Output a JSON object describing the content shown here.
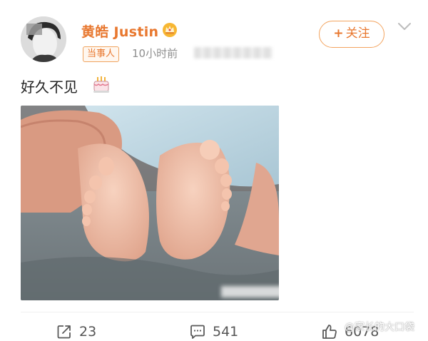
{
  "post": {
    "author": {
      "name": "黄皓 Justin",
      "badge": "当事人"
    },
    "time": "10小时前",
    "follow_label": "关注",
    "text": "好久不见",
    "stats": {
      "reposts": "23",
      "comments": "541",
      "likes": "6078"
    }
  },
  "watermark": "@家长的大口袋",
  "icons": {
    "vip": "crown-icon",
    "menu": "chevron-down-icon",
    "emoji": "birthday-cake-icon",
    "repost": "repost-icon",
    "comment": "comment-icon",
    "like": "thumbs-up-icon"
  },
  "colors": {
    "accent": "#e8772e",
    "follow_border": "#f3a45f",
    "muted_text": "#8e8e8e"
  }
}
